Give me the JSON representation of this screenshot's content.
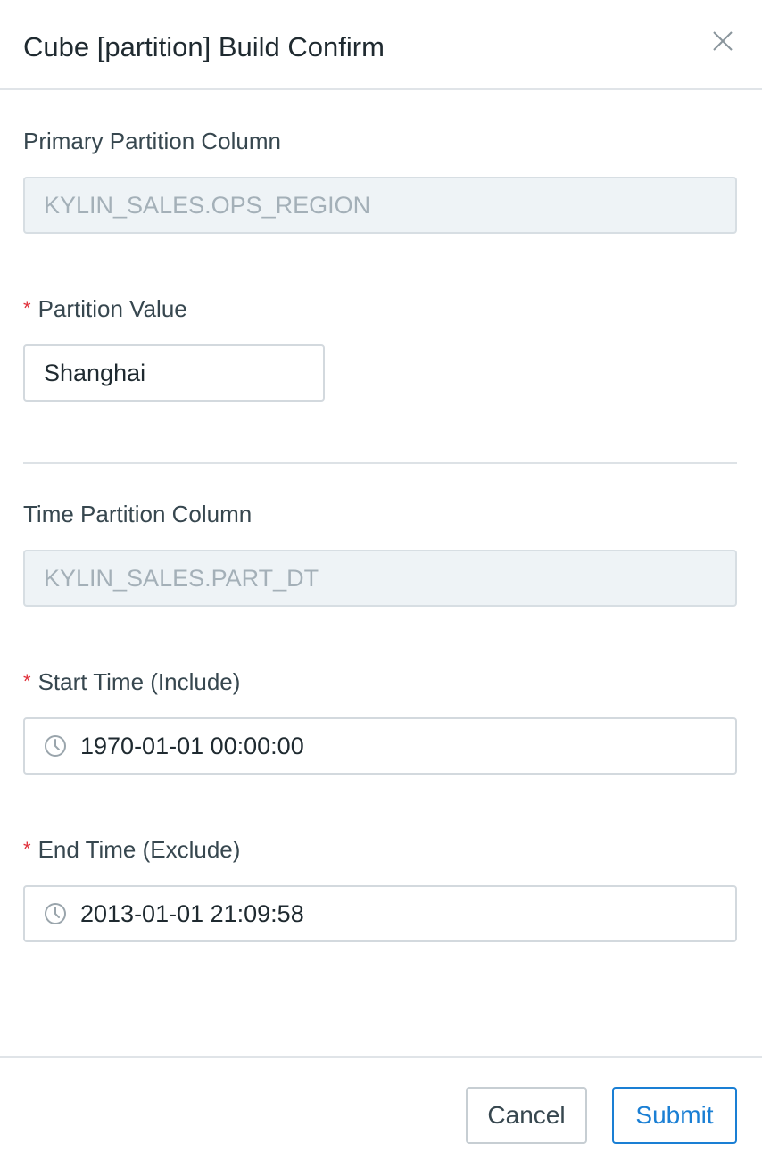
{
  "dialog": {
    "title": "Cube [partition] Build Confirm",
    "close_icon": "close-icon"
  },
  "form": {
    "primary_partition_column": {
      "label": "Primary Partition Column",
      "value": "KYLIN_SALES.OPS_REGION",
      "disabled": true
    },
    "partition_value": {
      "required_mark": "*",
      "label": "Partition Value",
      "value": "Shanghai"
    },
    "time_partition_column": {
      "label": "Time Partition Column",
      "value": "KYLIN_SALES.PART_DT",
      "disabled": true
    },
    "start_time": {
      "required_mark": "*",
      "label": "Start Time (Include)",
      "value": "1970-01-01 00:00:00",
      "icon": "clock-icon"
    },
    "end_time": {
      "required_mark": "*",
      "label": "End Time (Exclude)",
      "value": "2013-01-01 21:09:58",
      "icon": "clock-icon"
    }
  },
  "footer": {
    "cancel_label": "Cancel",
    "submit_label": "Submit"
  },
  "colors": {
    "accent": "#1a7fd4",
    "required": "#e0303a",
    "disabled_bg": "#eef3f6",
    "disabled_text": "#a4b0b8",
    "border": "#d3d9de"
  }
}
